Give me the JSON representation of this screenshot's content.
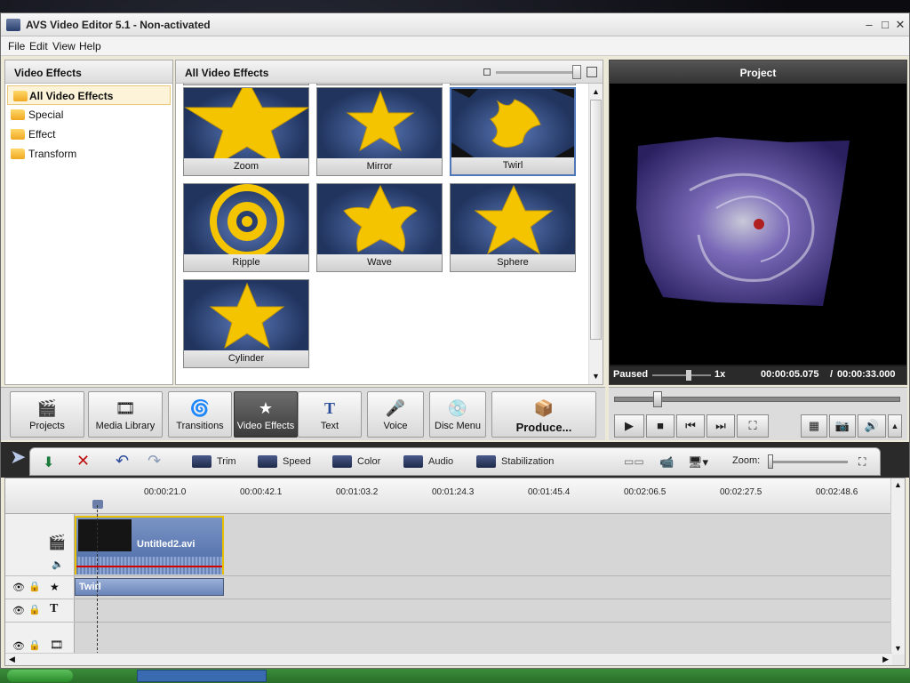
{
  "window": {
    "title": "AVS Video Editor 5.1 - Non-activated"
  },
  "menu": [
    "File",
    "Edit",
    "View",
    "Help"
  ],
  "left_panel": {
    "title": "Video Effects",
    "items": [
      "All Video Effects",
      "Special",
      "Effect",
      "Transform"
    ],
    "selected": "All Video Effects"
  },
  "gallery": {
    "title": "All Video Effects",
    "effects": [
      "Zoom",
      "Mirror",
      "Twirl",
      "Ripple",
      "Wave",
      "Sphere",
      "Cylinder"
    ],
    "selected": "Twirl"
  },
  "preview": {
    "title": "Project",
    "status": "Paused",
    "speed": "1x",
    "time_current": "00:00:05.075",
    "time_separator": "/",
    "time_total": "00:00:33.000"
  },
  "toolbar": {
    "buttons": [
      "Projects",
      "Media Library",
      "Transitions",
      "Video Effects",
      "Text",
      "Voice",
      "Disc Menu",
      "Produce..."
    ],
    "active": "Video Effects"
  },
  "timeline_tools": {
    "trim": "Trim",
    "speed": "Speed",
    "color": "Color",
    "audio": "Audio",
    "stabilization": "Stabilization",
    "zoom_label": "Zoom:"
  },
  "timeline": {
    "ticks": [
      "00:00:21.0",
      "00:00:42.1",
      "00:01:03.2",
      "00:01:24.3",
      "00:01:45.4",
      "00:02:06.5",
      "00:02:27.5",
      "00:02:48.6"
    ],
    "video_clip": "Untitled2.avi",
    "effect_clip": "Twirl"
  },
  "colors": {
    "accent": "#5078b8",
    "star": "#f5c400",
    "clip_border": "#e8c000",
    "audio_line": "#d00000"
  }
}
